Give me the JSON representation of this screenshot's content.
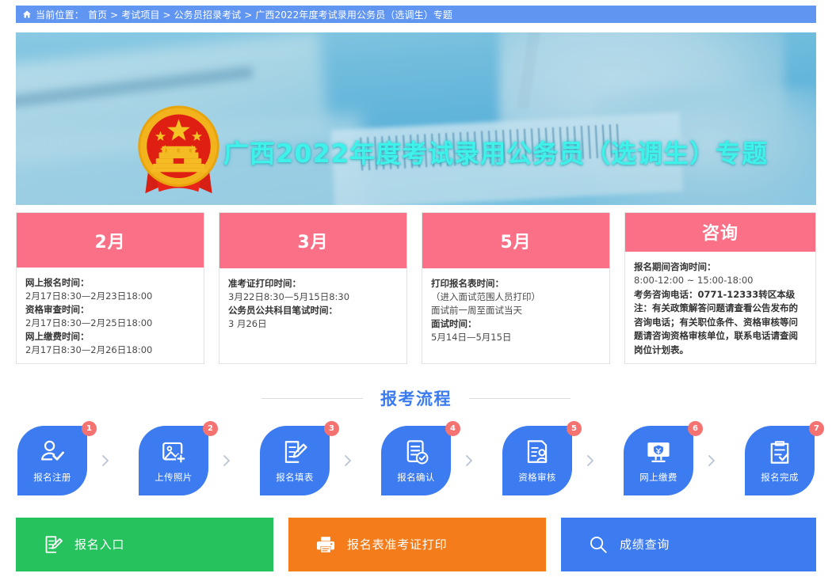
{
  "breadcrumb": {
    "icon": "home-icon",
    "label": "当前位置：",
    "path": "首页 > 考试项目 > 公务员招录考试 > 广西2022年度考试录用公务员（选调生）专题"
  },
  "banner": {
    "title": "广西2022年度考试录用公务员（选调生）专题",
    "emblem": "national-emblem-icon",
    "title_color": "#3EF2EA"
  },
  "cards": [
    {
      "title": "2月",
      "lines": [
        {
          "text": "网上报名时间：",
          "bold": true
        },
        {
          "text": "2月17日8:30—2月23日18:00",
          "bold": false
        },
        {
          "text": "资格审查时间：",
          "bold": true
        },
        {
          "text": "2月17日8:30—2月25日18:00",
          "bold": false
        },
        {
          "text": "网上缴费时间：",
          "bold": true
        },
        {
          "text": "2月17日8:30—2月26日18:00",
          "bold": false
        }
      ]
    },
    {
      "title": "3月",
      "lines": [
        {
          "text": "准考证打印时间：",
          "bold": true
        },
        {
          "text": "3月22日8:30—5月15日8:30",
          "bold": false
        },
        {
          "text": "公务员公共科目笔试时间：",
          "bold": true
        },
        {
          "text": "3 月26日",
          "bold": false
        }
      ]
    },
    {
      "title": "5月",
      "lines": [
        {
          "text": "打印报名表时间：",
          "bold": true
        },
        {
          "text": "（进入面试范围人员打印）",
          "bold": false
        },
        {
          "text": "面试前一周至面试当天",
          "bold": false
        },
        {
          "text": "面试时间：",
          "bold": true
        },
        {
          "text": "5月14日—5月15日",
          "bold": false
        }
      ]
    },
    {
      "title": "咨询",
      "lines": [
        {
          "text": "报名期间咨询时间：",
          "bold": true
        },
        {
          "text": "8:00-12:00 ~ 15:00-18:00",
          "bold": false
        },
        {
          "text": "考务咨询电话：0771-12333转区本级",
          "bold": true
        },
        {
          "text": "注：有关政策解答问题请查看公告发布的咨询电话；有关职位条件、资格审核等问题请咨询资格审核单位，联系电话请查阅岗位计划表。",
          "bold": false
        }
      ]
    }
  ],
  "flow": {
    "title": "报考流程",
    "title_color": "#3B7BF0",
    "steps": [
      {
        "num": "1",
        "label": "报名注册",
        "icon": "user-check-icon"
      },
      {
        "num": "2",
        "label": "上传照片",
        "icon": "image-add-icon"
      },
      {
        "num": "3",
        "label": "报名填表",
        "icon": "form-edit-icon"
      },
      {
        "num": "4",
        "label": "报名确认",
        "icon": "document-check-icon"
      },
      {
        "num": "5",
        "label": "资格审核",
        "icon": "id-review-icon"
      },
      {
        "num": "6",
        "label": "网上缴费",
        "icon": "online-payment-icon"
      },
      {
        "num": "7",
        "label": "报名完成",
        "icon": "clipboard-check-icon"
      }
    ],
    "separator_icon": "chevron-right-icon",
    "tile_color": "#3D7BF1",
    "badge_color": "#F4726F"
  },
  "actions": [
    {
      "label": "报名入口",
      "icon": "form-edit-icon",
      "color": "#25C25E"
    },
    {
      "label": "报名表准考证打印",
      "icon": "printer-icon",
      "color": "#F47C1B"
    },
    {
      "label": "成绩查询",
      "icon": "search-icon",
      "color": "#3D7BF1"
    }
  ]
}
